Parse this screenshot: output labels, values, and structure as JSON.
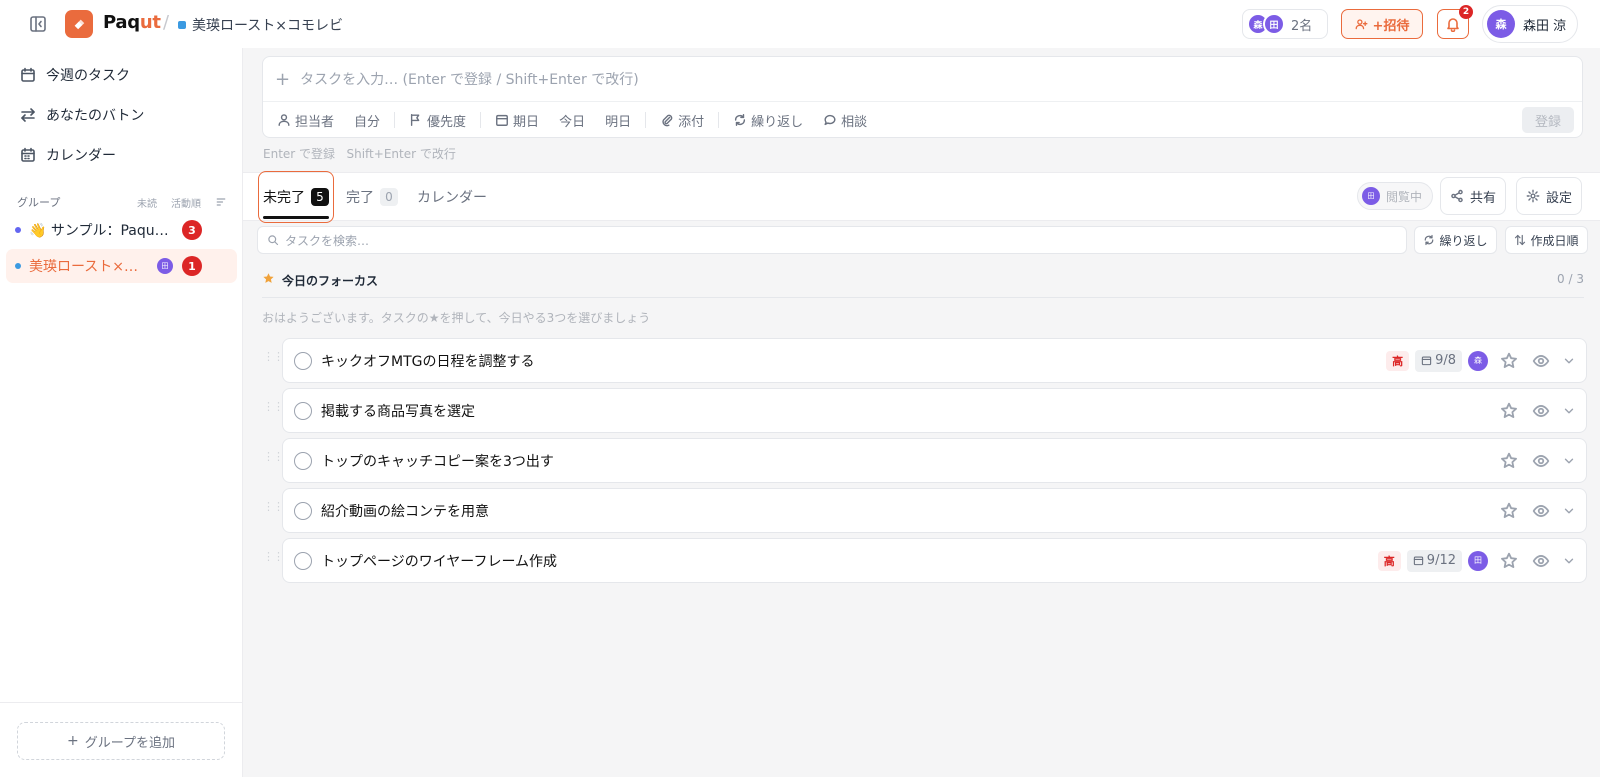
{
  "app": {
    "brand_main": "Paq",
    "brand_accent": "ut",
    "breadcrumb": "美瑛ロースト×コモレビ"
  },
  "header": {
    "member_avatars": [
      "森",
      "田"
    ],
    "member_count": "2名",
    "invite_label": "+招待",
    "notification_count": "2",
    "user_initial": "森",
    "user_name": "森田 涼"
  },
  "sidebar": {
    "nav": [
      {
        "label": "今週のタスク",
        "icon": "calendar-icon"
      },
      {
        "label": "あなたのバトン",
        "icon": "swap-icon"
      },
      {
        "label": "カレンダー",
        "icon": "calendar-grid-icon"
      }
    ],
    "group_header": {
      "label": "グループ",
      "opt1": "未読",
      "opt2": "活動順"
    },
    "groups": [
      {
        "label": "👋 サンプル：Paqu…",
        "dot_color": "#6366f1",
        "badge": "3",
        "active": false
      },
      {
        "label": "美瑛ロースト×…",
        "dot_color": "#3b9ae1",
        "badge": "1",
        "avatar": "田",
        "active": true
      }
    ],
    "add_group_label": "グループを追加"
  },
  "composer": {
    "placeholder": "タスクを入力… (Enter で登録 / Shift+Enter で改行)",
    "tools": {
      "assignee": "担当者",
      "me": "自分",
      "priority": "優先度",
      "due": "期日",
      "today": "今日",
      "tomorrow": "明日",
      "attach": "添付",
      "repeat": "繰り返し",
      "consult": "相談"
    },
    "submit_label": "登録",
    "hint_enter": "Enter で登録",
    "hint_shift": "Shift+Enter で改行"
  },
  "tabs": [
    {
      "label": "未完了",
      "count": "5",
      "active": true
    },
    {
      "label": "完了",
      "count": "0",
      "active": false
    },
    {
      "label": "カレンダー",
      "active": false
    }
  ],
  "toolbar": {
    "viewing_avatar": "田",
    "viewing_label": "閲覧中",
    "share_label": "共有",
    "settings_label": "設定",
    "search_placeholder": "タスクを検索…",
    "repeat_filter": "繰り返し",
    "sort_label": "作成日順"
  },
  "focus": {
    "title": "今日のフォーカス",
    "count": "0 / 3",
    "hint": "おはようございます。タスクの★を押して、今日やる3つを選びましょう"
  },
  "tasks": [
    {
      "title": "キックオフMTGの日程を調整する",
      "priority": "高",
      "due": "9/8",
      "assignee": "森"
    },
    {
      "title": "掲載する商品写真を選定"
    },
    {
      "title": "トップのキャッチコピー案を3つ出す"
    },
    {
      "title": "紹介動画の絵コンテを用意"
    },
    {
      "title": "トップページのワイヤーフレーム作成",
      "priority": "高",
      "due": "9/12",
      "assignee": "田"
    }
  ],
  "colors": {
    "accent": "#ea6b3d",
    "avatar": "#7c5ce6",
    "badge": "#dc2626"
  }
}
